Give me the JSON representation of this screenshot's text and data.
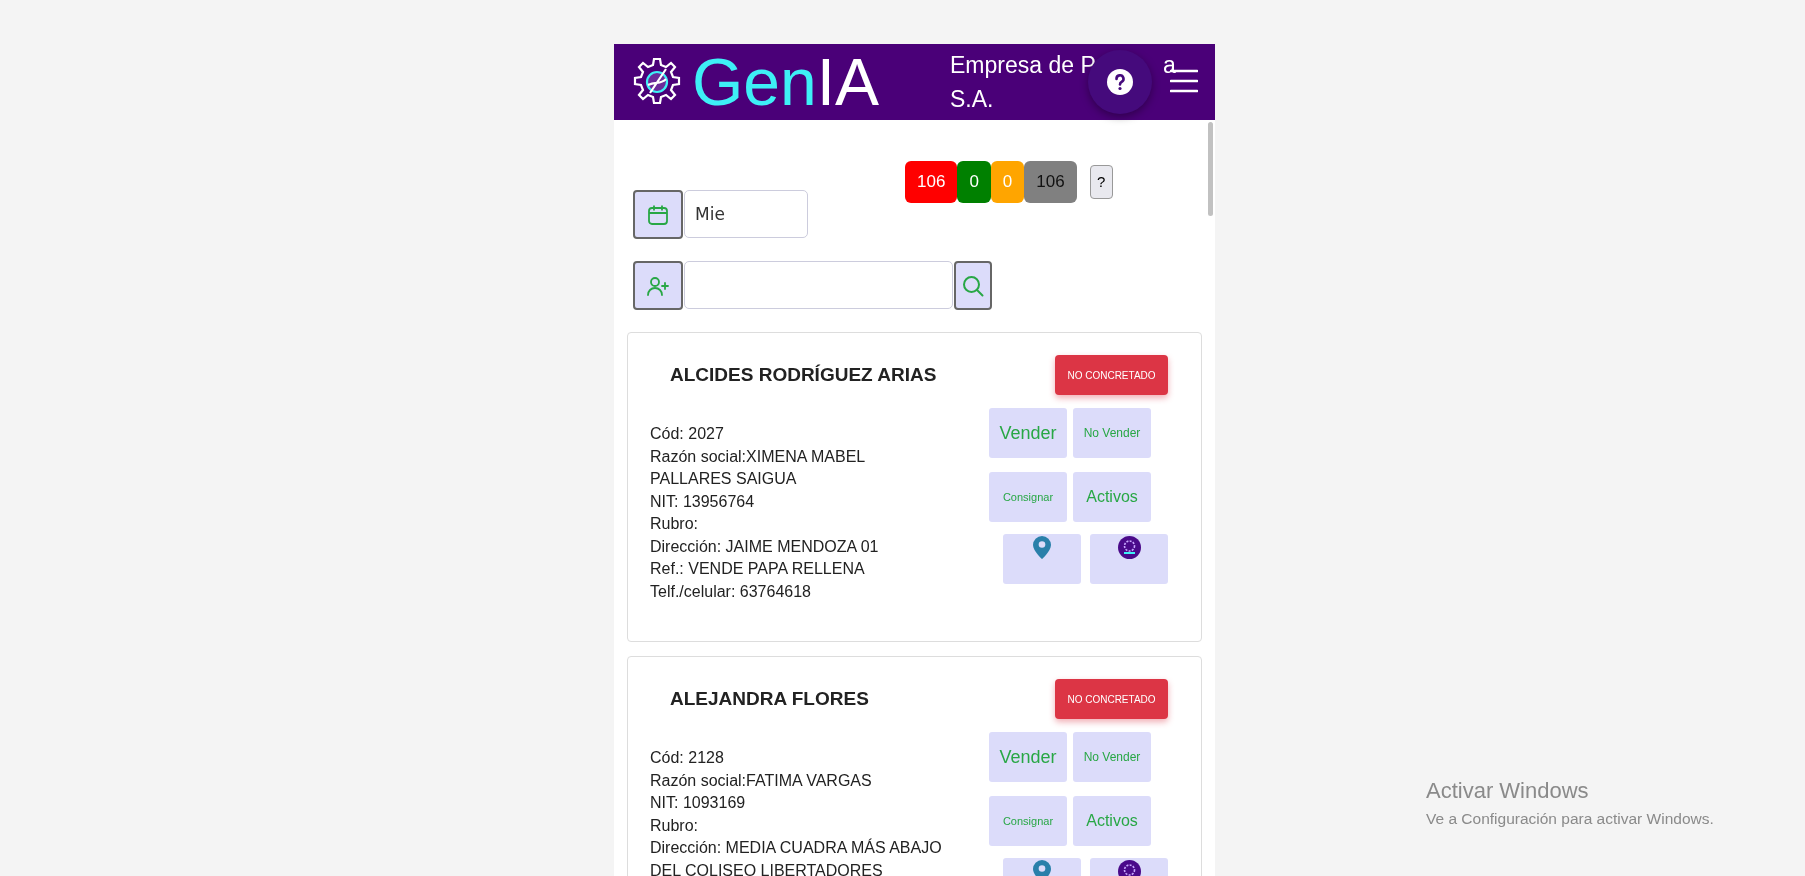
{
  "header": {
    "brand": {
      "accent": "Gen",
      "rest": "IA"
    },
    "company_lines": [
      [
        "Empresa de P",
        "a"
      ],
      [
        "S.A."
      ]
    ]
  },
  "counters": [
    {
      "value": "106",
      "color": "#ff0000",
      "dark_text": false
    },
    {
      "value": "0",
      "color": "#008000",
      "dark_text": false
    },
    {
      "value": "0",
      "color": "#ffa500",
      "dark_text": false
    },
    {
      "value": "106",
      "color": "#808080",
      "dark_text": true
    }
  ],
  "counters_help": "?",
  "day_field": {
    "value": "Mie"
  },
  "clients": [
    {
      "name": "ALCIDES RODRÍGUEZ ARIAS",
      "status": "NO CONCRETADO",
      "details": [
        "Cód: 2027",
        "Razón social:XIMENA MABEL PALLARES SAIGUA",
        "NIT: 13956764",
        "Rubro:",
        "Dirección: JAIME MENDOZA 01",
        "Ref.: VENDE PAPA RELLENA",
        "Telf./celular: 63764618"
      ],
      "actions": [
        "Vender",
        "No Vender",
        "Consignar",
        "Activos"
      ]
    },
    {
      "name": "ALEJANDRA FLORES",
      "status": "NO CONCRETADO",
      "details": [
        "Cód: 2128",
        "Razón social:FATIMA VARGAS",
        "NIT: 1093169",
        "Rubro:",
        "Dirección: MEDIA CUADRA MÁS ABAJO DEL COLISEO LIBERTADORES"
      ],
      "actions": [
        "Vender",
        "No Vender",
        "Consignar",
        "Activos"
      ]
    }
  ],
  "os_notice": {
    "title": "Activar Windows",
    "text": "Ve a Configuración para activar Windows."
  }
}
